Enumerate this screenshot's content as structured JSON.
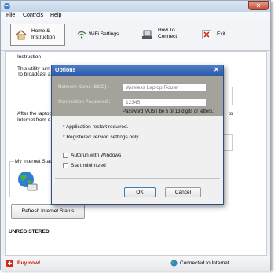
{
  "menu": [
    "File",
    "Controls",
    "Help"
  ],
  "window_close": "✕",
  "toolbar": {
    "home_label": "Home &\nInstruction",
    "wifi_label": "WiFi Settings",
    "howto_label": "How To\nConnect",
    "exit_label": "Exit"
  },
  "main": {
    "instruction_heading": "Instruction",
    "intro_line1": "This utility turn",
    "intro_line2": "To broadcast a",
    "after_line1": "After the laptop",
    "after_line1_tail": "to",
    "after_line2": "Internet from o",
    "group_title": "My Internet Stat",
    "refresh_button": "Refresh Internet Status",
    "registration_status": "UNREGISTERED"
  },
  "status": {
    "buy_now": "Buy now!",
    "connection": "Connected to Internet"
  },
  "dialog": {
    "title": "Options",
    "close": "✕",
    "network_name_label": "Network Name (SSID) :",
    "network_name_value": "Wireless Laptop Router",
    "password_label": "Connection Password :",
    "password_value": "12345",
    "password_hint": "Password MUST be 5 or 13 digits or letters.",
    "note1": "* Application restart required.",
    "note2": "* Registered version settings only.",
    "autorun_label": "Autorun with Windows",
    "start_minimized_label": "Start minimized",
    "ok_label": "OK",
    "cancel_label": "Cancel"
  },
  "colors": {
    "dialog_title": "#2a5aa8",
    "buy_now": "#cc1100",
    "dialog_top_panel": "#a5a29c"
  }
}
